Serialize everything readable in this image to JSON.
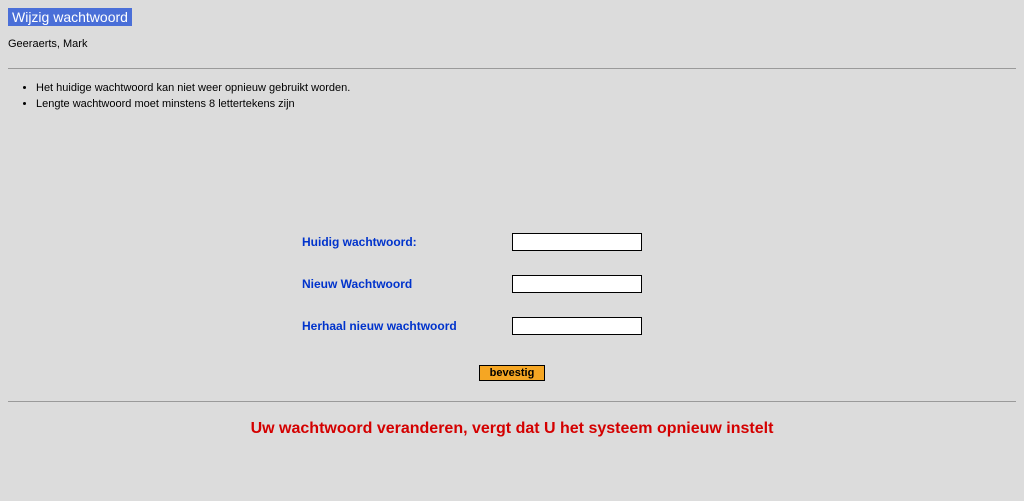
{
  "title": "Wijzig wachtwoord ",
  "username": "Geeraerts, Mark",
  "rules": {
    "0": "Het huidige wachtwoord kan niet weer opnieuw gebruikt worden.",
    "1": "Lengte wachtwoord moet minstens 8 lettertekens zijn"
  },
  "form": {
    "current_label": "Huidig wachtwoord:",
    "new_label": "Nieuw Wachtwoord",
    "repeat_label": "Herhaal nieuw wachtwoord",
    "confirm_button": "bevestig"
  },
  "warning": "Uw wachtwoord veranderen, vergt dat U het systeem opnieuw instelt"
}
